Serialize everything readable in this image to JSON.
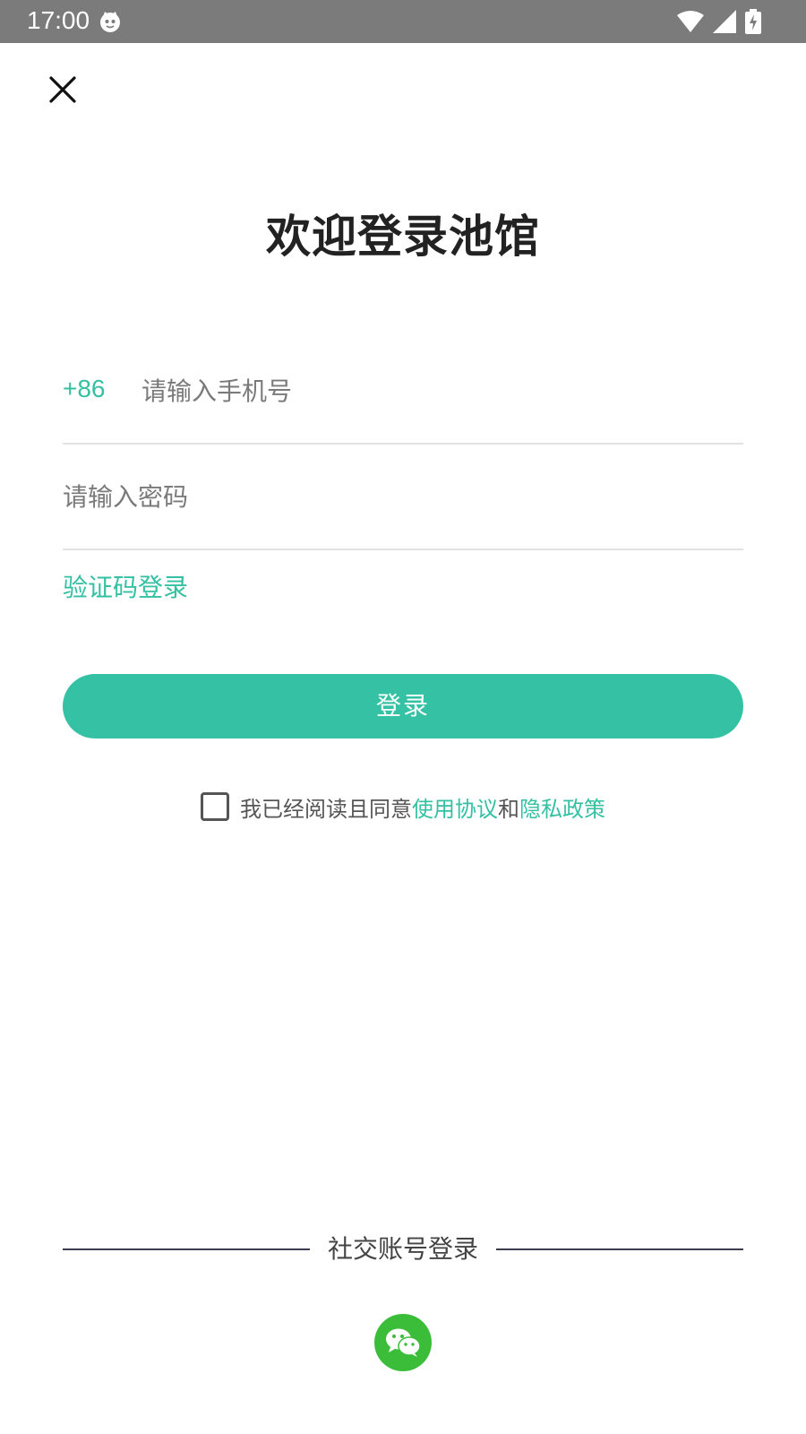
{
  "status_bar": {
    "time": "17:00"
  },
  "header": {
    "close_icon": "close-icon",
    "title": "欢迎登录池馆"
  },
  "form": {
    "country_code": "+86",
    "phone_placeholder": "请输入手机号",
    "phone_value": "",
    "password_placeholder": "请输入密码",
    "password_value": "",
    "sms_login_link": "验证码登录",
    "login_button": "登录"
  },
  "agreement": {
    "checked": false,
    "prefix": "我已经阅读且同意",
    "terms_link": "使用协议",
    "conjunction": "和",
    "privacy_link": "隐私政策"
  },
  "social": {
    "divider_label": "社交账号登录",
    "wechat_icon": "wechat-icon"
  },
  "colors": {
    "accent": "#35c1a4",
    "status_bar": "#7b7b7b",
    "wechat": "#3bbd3a",
    "title": "#222222"
  }
}
